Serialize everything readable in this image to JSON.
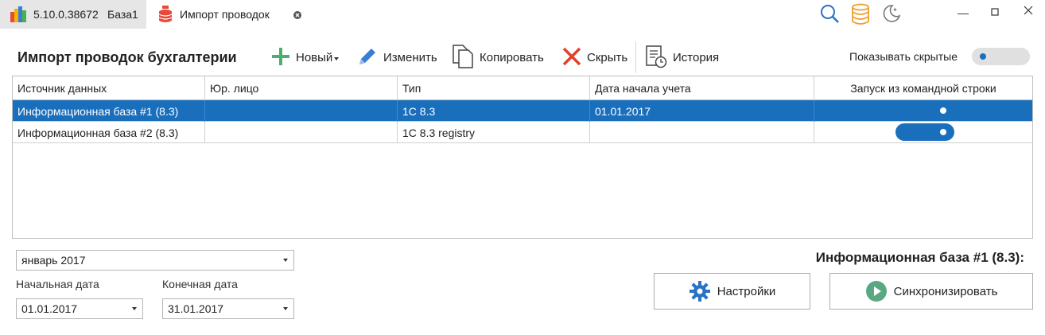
{
  "titlebar": {
    "version": "5.10.0.38672",
    "base_name": "База1",
    "doc_tab_title": "Импорт проводок"
  },
  "toolbar": {
    "page_title": "Импорт проводок бухгалтерии",
    "new_label": "Новый",
    "edit_label": "Изменить",
    "copy_label": "Копировать",
    "hide_label": "Скрыть",
    "history_label": "История",
    "show_hidden_label": "Показывать скрытые"
  },
  "grid": {
    "columns": [
      "Источник данных",
      "Юр. лицо",
      "Тип",
      "Дата начала учета",
      "Запуск из командной строки"
    ],
    "rows": [
      {
        "source": "Информационная база #1 (8.3)",
        "entity": "",
        "type": "1С 8.3",
        "start_date": "01.01.2017",
        "cmdline": true,
        "selected": true
      },
      {
        "source": "Информационная база #2 (8.3)",
        "entity": "",
        "type": "1С 8.3 registry",
        "start_date": "",
        "cmdline": true,
        "selected": false
      }
    ]
  },
  "period": {
    "period_value": "январь 2017",
    "start_label": "Начальная дата",
    "end_label": "Конечная дата",
    "start_value": "01.01.2017",
    "end_value": "31.01.2017"
  },
  "details": {
    "base_title": "Информационная база #1 (8.3):",
    "settings_label": "Настройки",
    "sync_label": "Синхронизировать"
  },
  "colors": {
    "accent": "#1a6fbd",
    "add_green": "#4caf72",
    "hide_red": "#e0412a"
  }
}
